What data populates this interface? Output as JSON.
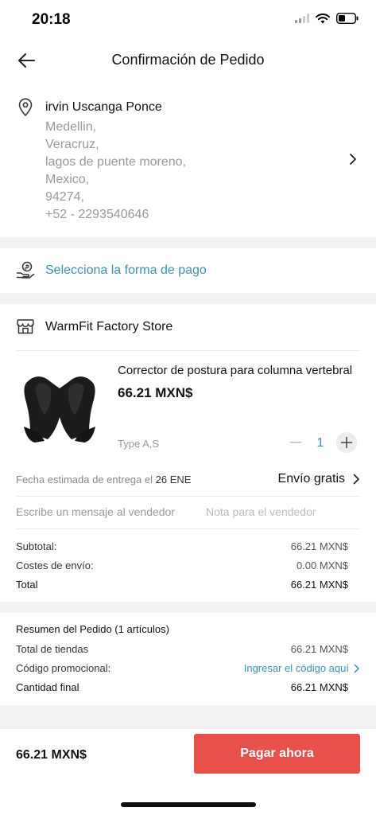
{
  "status_bar": {
    "time": "20:18"
  },
  "header": {
    "title": "Confirmación de Pedido"
  },
  "address": {
    "name": "irvin Uscanga Ponce",
    "lines": [
      "Medellin,",
      "Veracruz,",
      "lagos de puente moreno,",
      "Mexico,",
      "94274,",
      "+52 - 2293540646"
    ]
  },
  "payment": {
    "label": "Selecciona la forma de pago"
  },
  "store": {
    "name": "WarmFit Factory Store"
  },
  "product": {
    "title": "Corrector de postura para columna vertebral",
    "price": "66.21 MXN$",
    "variant": "Type A,S",
    "quantity": "1"
  },
  "delivery": {
    "label": "Fecha estimada de entrega el",
    "date": "26 ENE",
    "shipping": "Envío gratis"
  },
  "message": {
    "label": "Escribe un mensaje al vendedor",
    "placeholder": "Nota para el vendedor"
  },
  "totals": {
    "subtotal_label": "Subtotal:",
    "subtotal_value": "66.21 MXN$",
    "shipping_label": "Costes de envío:",
    "shipping_value": "0.00 MXN$",
    "total_label": "Total",
    "total_value": "66.21 MXN$"
  },
  "summary": {
    "title": "Resumen del Pedido (1 artículos)",
    "stores_label": "Total de tiendas",
    "stores_value": "66.21 MXN$",
    "promo_label": "Código promocional:",
    "promo_link": "Ingresar el código aquí",
    "final_label": "Cantidad final",
    "final_value": "66.21 MXN$"
  },
  "footer": {
    "total": "66.21 MXN$",
    "pay_button": "Pagar ahora"
  },
  "colors": {
    "accent_link": "#3d8fb3",
    "pay_button": "#e8504b",
    "section_gap": "#f2f2f2"
  }
}
